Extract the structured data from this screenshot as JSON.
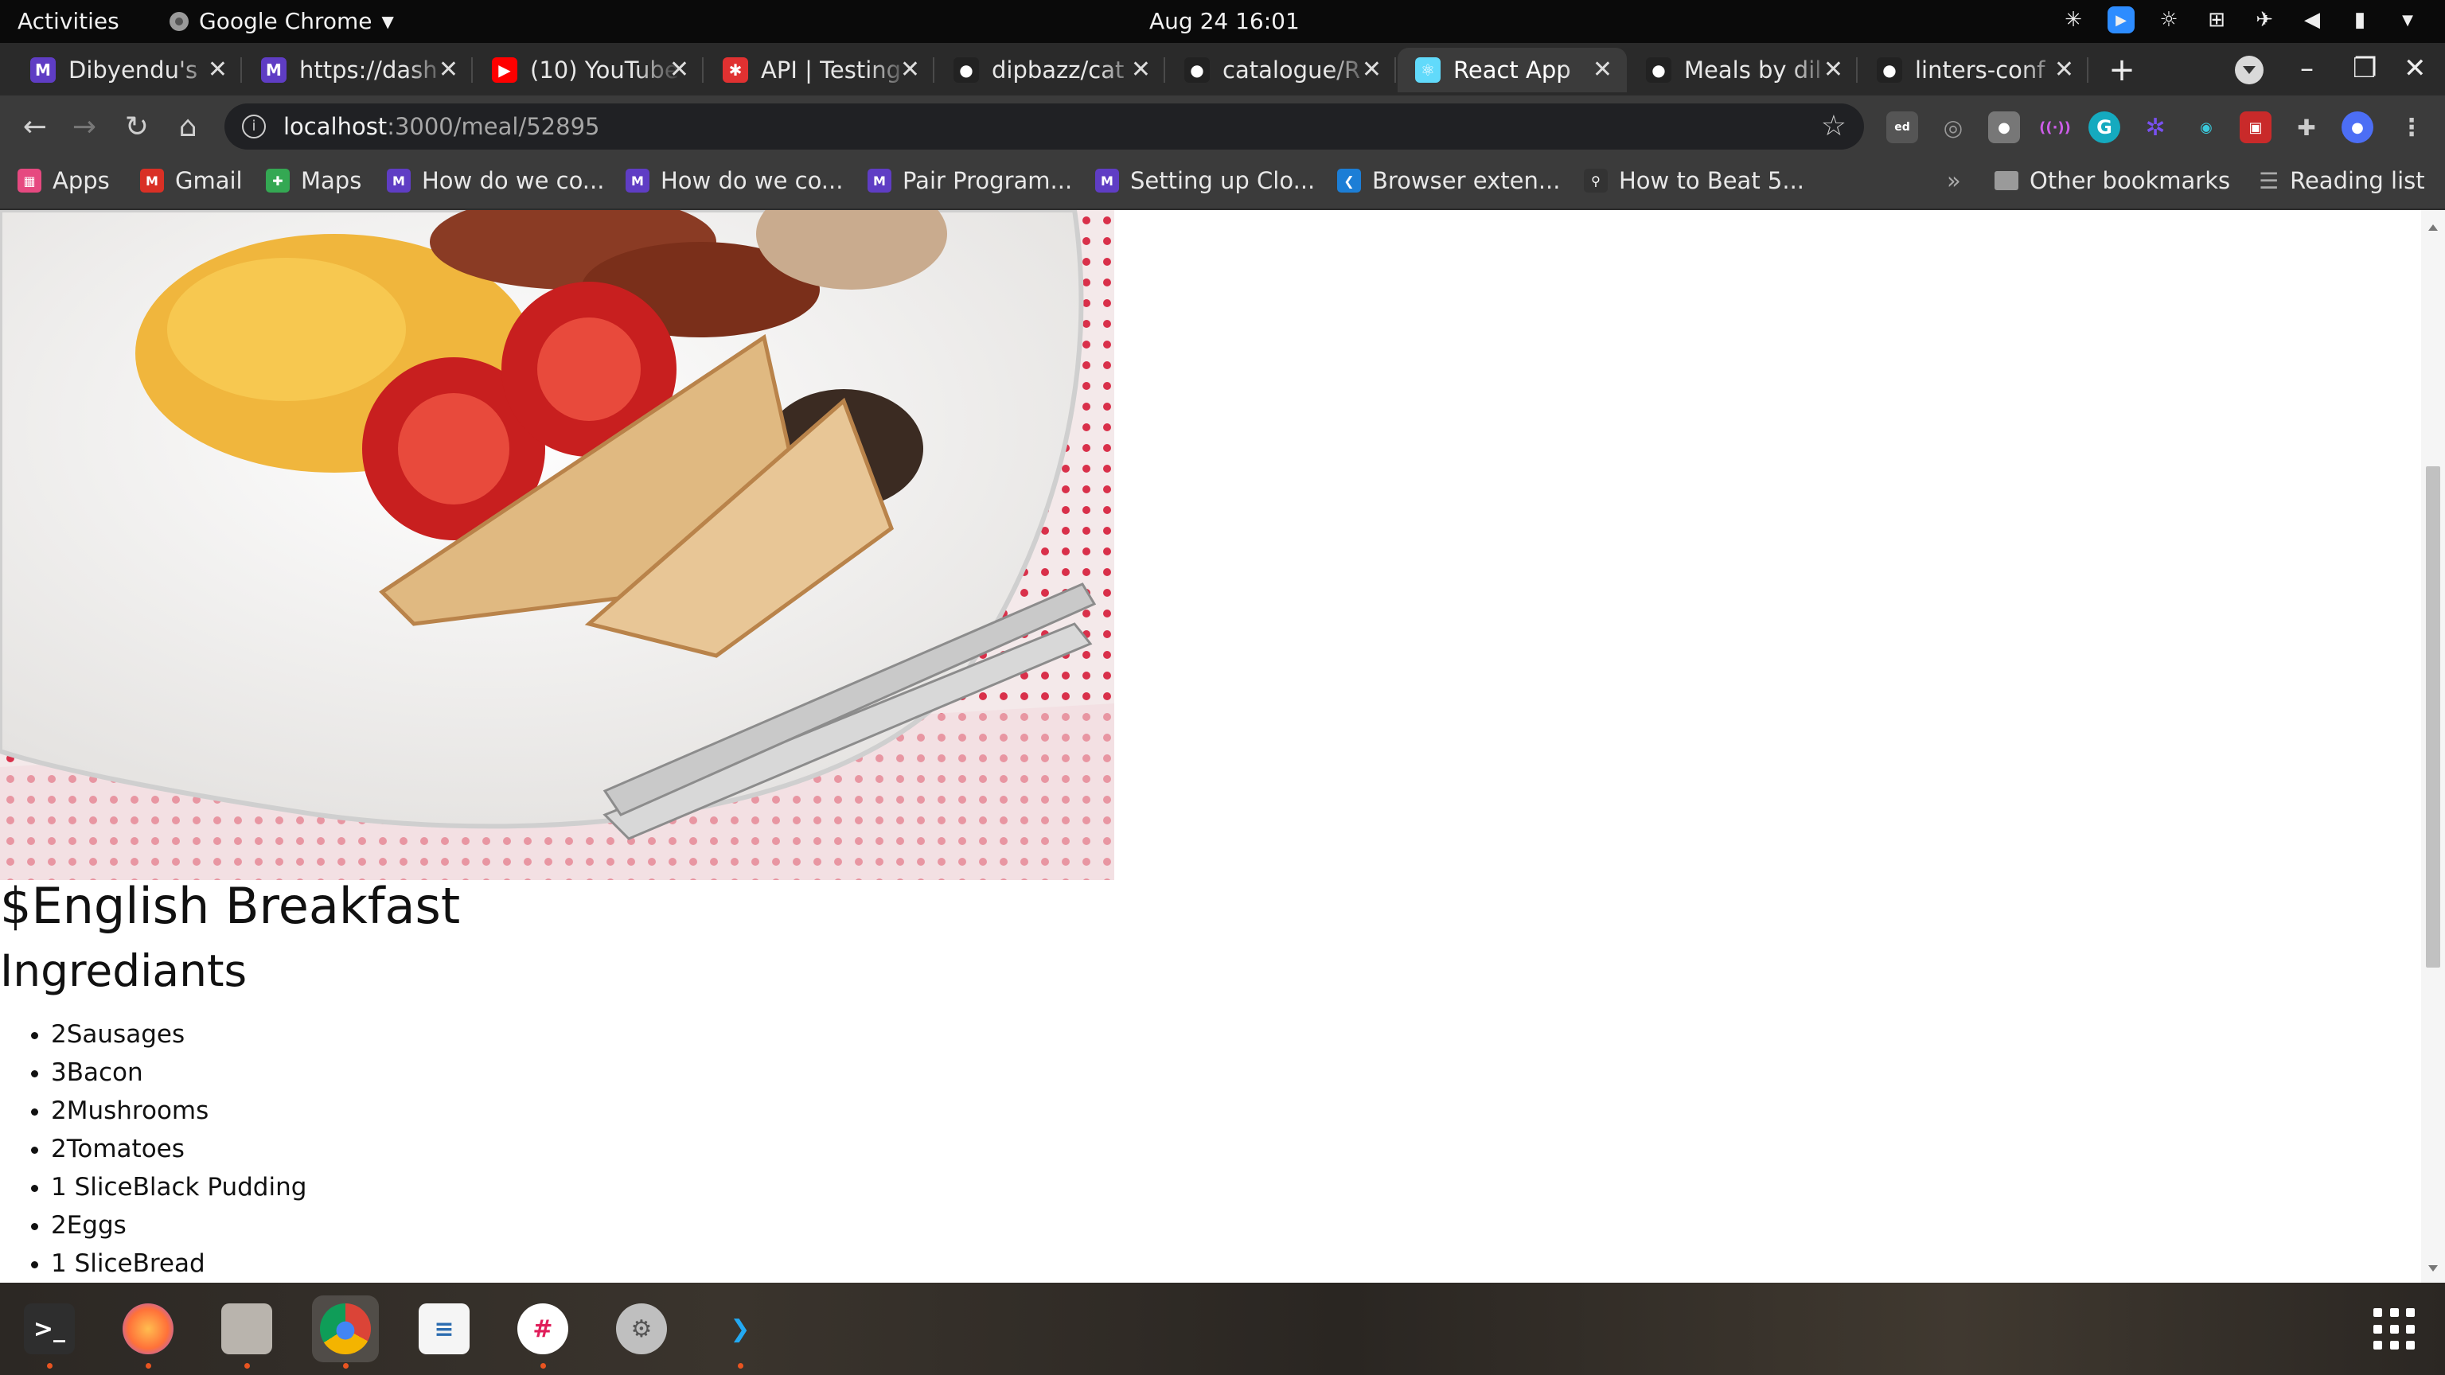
{
  "topbar": {
    "activities": "Activities",
    "app_name": "Google Chrome",
    "clock": "Aug 24  16:01"
  },
  "tabs": [
    {
      "title": "Dibyendu's",
      "favicon": "microverse-icon",
      "color": "#5f3dc4"
    },
    {
      "title": "https://dash",
      "favicon": "microverse-icon",
      "color": "#5f3dc4"
    },
    {
      "title": "(10) YouTube",
      "favicon": "youtube-icon",
      "color": "#ff0000"
    },
    {
      "title": "API | Testing",
      "favicon": "postman-icon",
      "color": "#e03131"
    },
    {
      "title": "dipbazz/cat",
      "favicon": "github-icon",
      "color": "#222222"
    },
    {
      "title": "catalogue/R",
      "favicon": "github-icon",
      "color": "#222222"
    },
    {
      "title": "React App",
      "favicon": "react-icon",
      "color": "#61dafb",
      "active": true
    },
    {
      "title": "Meals by dil",
      "favicon": "github-icon",
      "color": "#222222"
    },
    {
      "title": "linters-conf",
      "favicon": "github-icon",
      "color": "#222222"
    }
  ],
  "omnibox": {
    "host": "localhost",
    "path": ":3000/meal/52895"
  },
  "bookmarks": [
    {
      "label": "Apps",
      "icon": "apps-icon",
      "color": "#e64980"
    },
    {
      "label": "Gmail",
      "icon": "gmail-icon",
      "color": "#d93025"
    },
    {
      "label": "Maps",
      "icon": "maps-icon",
      "color": "#34a853"
    },
    {
      "label": "How do we co...",
      "icon": "microverse-icon",
      "color": "#5f3dc4"
    },
    {
      "label": "How do we co...",
      "icon": "microverse-icon",
      "color": "#5f3dc4"
    },
    {
      "label": "Pair Program...",
      "icon": "microverse-icon",
      "color": "#5f3dc4"
    },
    {
      "label": "Setting up Clo...",
      "icon": "microverse-icon",
      "color": "#5f3dc4"
    },
    {
      "label": "Browser exten...",
      "icon": "extension-icon",
      "color": "#1c7ed6"
    },
    {
      "label": "How to Beat 5...",
      "icon": "link-icon",
      "color": "#333333"
    }
  ],
  "bookmarks_right": {
    "other": "Other bookmarks",
    "reading": "Reading list",
    "overflow": "»"
  },
  "page": {
    "title": "$English Breakfast",
    "ingredients_heading": "Ingrediants",
    "ingredients": [
      "2Sausages",
      "3Bacon",
      "2Mushrooms",
      "2Tomatoes",
      "1 SliceBlack Pudding",
      "2Eggs",
      "1 SliceBread"
    ]
  },
  "dock": [
    {
      "name": "terminal-icon"
    },
    {
      "name": "firefox-icon"
    },
    {
      "name": "files-icon"
    },
    {
      "name": "chrome-icon",
      "active": true
    },
    {
      "name": "text-editor-icon"
    },
    {
      "name": "slack-icon"
    },
    {
      "name": "settings-icon"
    },
    {
      "name": "vscode-icon"
    }
  ]
}
